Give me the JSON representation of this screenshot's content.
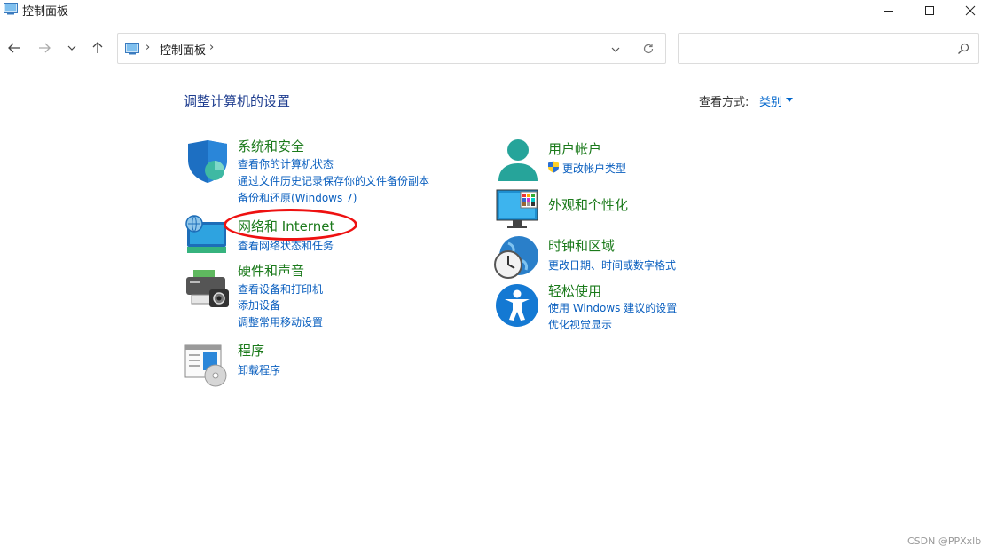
{
  "window": {
    "title": "控制面板"
  },
  "address": {
    "crumb": "控制面板",
    "sep": "›"
  },
  "search": {
    "placeholder": ""
  },
  "heading": "调整计算机的设置",
  "view": {
    "label": "查看方式:",
    "value": "类别"
  },
  "categories": {
    "security": {
      "title": "系统和安全",
      "links": [
        "查看你的计算机状态",
        "通过文件历史记录保存你的文件备份副本",
        "备份和还原(Windows 7)"
      ]
    },
    "network": {
      "title": "网络和 Internet",
      "links": [
        "查看网络状态和任务"
      ]
    },
    "hardware": {
      "title": "硬件和声音",
      "links": [
        "查看设备和打印机",
        "添加设备",
        "调整常用移动设置"
      ]
    },
    "programs": {
      "title": "程序",
      "links": [
        "卸载程序"
      ]
    },
    "accounts": {
      "title": "用户帐户",
      "links": [
        "更改帐户类型"
      ]
    },
    "appearance": {
      "title": "外观和个性化",
      "links": []
    },
    "clock": {
      "title": "时钟和区域",
      "links": [
        "更改日期、时间或数字格式"
      ]
    },
    "ease": {
      "title": "轻松使用",
      "links": [
        "使用 Windows 建议的设置",
        "优化视觉显示"
      ]
    }
  },
  "watermark": "CSDN @PPXxlb",
  "colors": {
    "heading": "#1e3d8f",
    "category_title": "#1b7a1b",
    "link": "#0a5fbf",
    "annotation": "#e11111"
  }
}
